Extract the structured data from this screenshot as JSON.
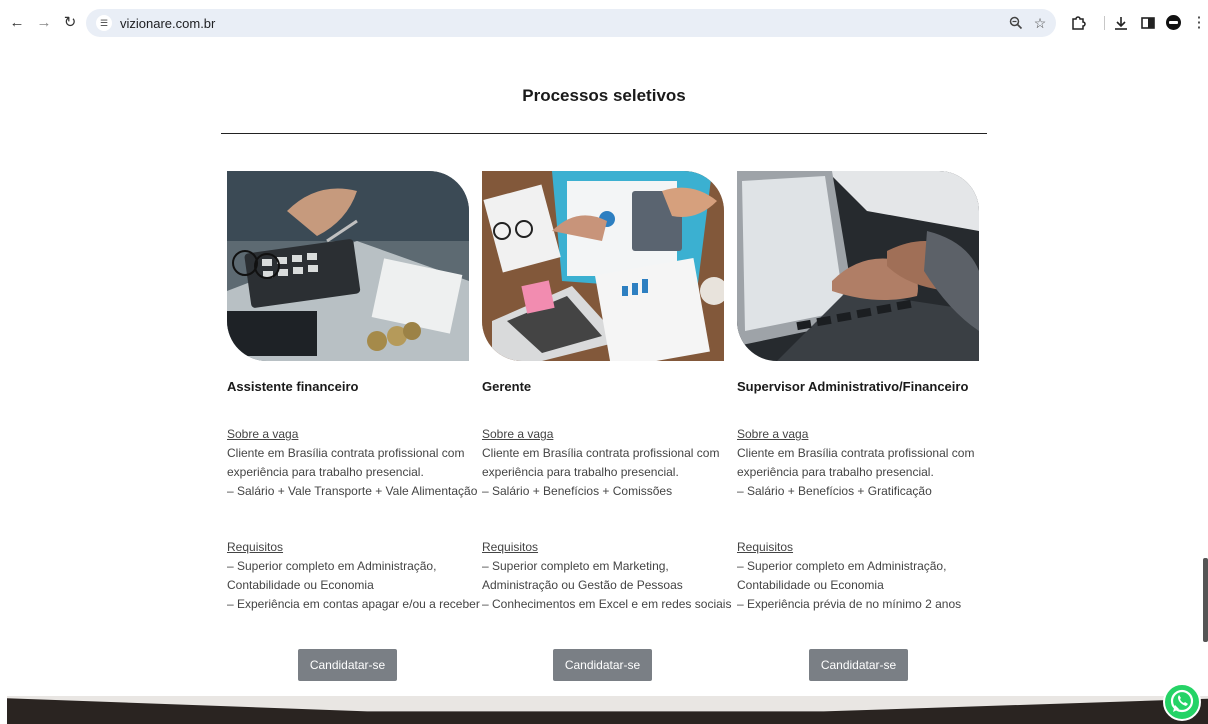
{
  "browser": {
    "url": "vizionare.com.br",
    "icons": {
      "back": "arrow-left-icon",
      "forward": "arrow-right-icon",
      "reload": "reload-icon",
      "site_info": "tune-icon",
      "zoom": "zoom-icon",
      "bookmark": "star-icon",
      "extensions": "puzzle-icon",
      "download": "download-icon",
      "side_panel": "side-panel-icon",
      "menu": "kebab-menu-icon"
    }
  },
  "page": {
    "title": "Processos seletivos"
  },
  "jobs": [
    {
      "title": "Assistente financeiro",
      "about_title": "Sobre a vaga",
      "about_lines": [
        "Cliente em Brasília contrata profissional com",
        "experiência para trabalho presencial.",
        "– Salário + Vale Transporte + Vale Alimentação"
      ],
      "req_title": "Requisitos",
      "req_lines": [
        "– Superior completo em Administração,",
        "Contabilidade ou Economia",
        "– Experiência em contas apagar e/ou a receber"
      ],
      "button": "Candidatar-se"
    },
    {
      "title": "Gerente",
      "about_title": "Sobre a vaga",
      "about_lines": [
        "Cliente em Brasília contrata profissional com",
        "experiência para trabalho presencial.",
        "– Salário + Benefícios + Comissões"
      ],
      "req_title": "Requisitos",
      "req_lines": [
        "– Superior completo em Marketing,",
        "Administração ou Gestão de Pessoas",
        "– Conhecimentos em Excel e em redes sociais"
      ],
      "button": "Candidatar-se"
    },
    {
      "title": "Supervisor Administrativo/Financeiro",
      "about_title": "Sobre a vaga",
      "about_lines": [
        "Cliente em Brasília contrata profissional com",
        "experiência para trabalho presencial.",
        "– Salário + Benefícios + Gratificação"
      ],
      "req_title": "Requisitos",
      "req_lines": [
        "– Superior completo em Administração,",
        "Contabilidade ou Economia",
        "– Experiência prévia de no mínimo 2 anos"
      ],
      "button": "Candidatar-se"
    }
  ],
  "floating": {
    "whatsapp_icon": "whatsapp-icon"
  }
}
